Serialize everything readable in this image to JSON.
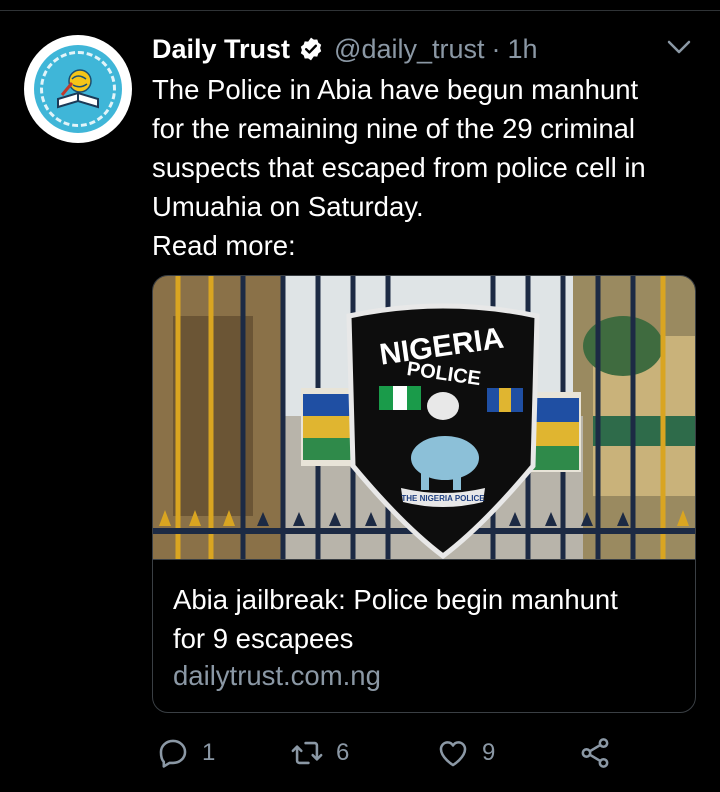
{
  "tweet": {
    "author": "Daily Trust",
    "handle": "@daily_trust",
    "separator": "·",
    "time": "1h",
    "lines": [
      "The Police in Abia have begun manhunt",
      "for the remaining nine of the 29 criminal",
      "suspects that escaped from police cell in",
      "Umuahia on Saturday.",
      "Read more:"
    ]
  },
  "card": {
    "title_lines": [
      "Abia jailbreak: Police begin manhunt",
      "for 9 escapees"
    ],
    "domain": "dailytrust.com.ng",
    "image": {
      "badge_top": "NIGERIA",
      "badge_mid": "POLICE",
      "badge_ribbon": "THE NIGERIA POLICE"
    }
  },
  "actions": {
    "replies": "1",
    "retweets": "6",
    "likes": "9"
  },
  "colors": {
    "background": "#000000",
    "text": "#ffffff",
    "secondary": "#8b98a5",
    "divider": "#2f3336",
    "avatar_blue": "#3fb6d8"
  },
  "icons": {
    "verified": "verified-icon",
    "menu": "chevron-down-icon",
    "reply": "reply-icon",
    "retweet": "retweet-icon",
    "like": "heart-icon",
    "share": "share-icon"
  }
}
